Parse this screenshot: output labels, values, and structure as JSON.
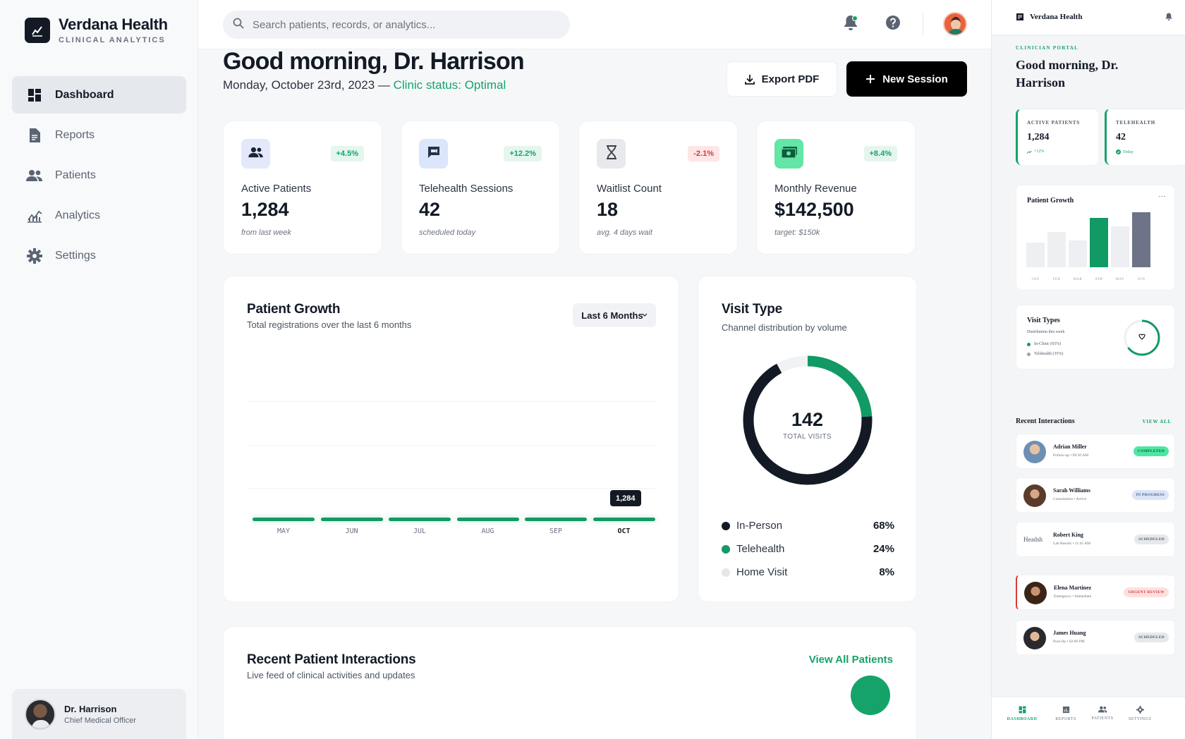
{
  "brand": {
    "name": "Verdana Health",
    "subtitle": "CLINICAL ANALYTICS"
  },
  "sidebar": {
    "items": [
      {
        "label": "Dashboard",
        "icon": "dashboard-icon",
        "active": true
      },
      {
        "label": "Reports",
        "icon": "document-icon",
        "active": false
      },
      {
        "label": "Patients",
        "icon": "users-icon",
        "active": false
      },
      {
        "label": "Analytics",
        "icon": "chart-icon",
        "active": false
      },
      {
        "label": "Settings",
        "icon": "gear-icon",
        "active": false
      }
    ],
    "user": {
      "name": "Dr. Harrison",
      "role": "Chief Medical Officer"
    }
  },
  "topbar": {
    "search_placeholder": "Search patients, records, or analytics...",
    "has_notification": true
  },
  "header": {
    "greeting": "Good morning, Dr. Harrison",
    "date": "Monday, October 23rd, 2023 — ",
    "status": "Clinic status: Optimal",
    "export_label": "Export PDF",
    "new_session_label": "New Session"
  },
  "stats": [
    {
      "label": "Active Patients",
      "value": "1,284",
      "delta": "+4.5%",
      "trend": "up",
      "note": "from last week",
      "icon": "users-icon",
      "tint": "#e3e8fb",
      "ink": "#1f2433"
    },
    {
      "label": "Telehealth Sessions",
      "value": "42",
      "delta": "+12.2%",
      "trend": "up",
      "note": "scheduled today",
      "icon": "video-chat-icon",
      "tint": "#dbe5fb",
      "ink": "#273049"
    },
    {
      "label": "Waitlist Count",
      "value": "18",
      "delta": "-2.1%",
      "trend": "down",
      "note": "avg. 4 days wait",
      "icon": "hourglass-icon",
      "tint": "#e8e9ec",
      "ink": "#3b3f47"
    },
    {
      "label": "Monthly Revenue",
      "value": "$142,500",
      "delta": "+8.4%",
      "trend": "up",
      "note": "target: $150k",
      "icon": "cash-icon",
      "tint": "#63e6a6",
      "ink": "#0d5c3d"
    }
  ],
  "growth": {
    "title": "Patient Growth",
    "subtitle": "Total registrations over the last 6 months",
    "range_label": "Last 6 Months",
    "tooltip": "1,284"
  },
  "chart_data": {
    "type": "bar",
    "categories": [
      "MAY",
      "JUN",
      "JUL",
      "AUG",
      "SEP",
      "OCT"
    ],
    "values": [
      0,
      0,
      0,
      0,
      0,
      0
    ],
    "highlight": "OCT",
    "grid": true
  },
  "visit_type": {
    "title": "Visit Type",
    "subtitle": "Channel distribution by volume",
    "total": "142",
    "total_label": "TOTAL VISITS",
    "legend": [
      {
        "label": "In-Person",
        "pct": "68%",
        "value": 68,
        "color": "#131a26"
      },
      {
        "label": "Telehealth",
        "pct": "24%",
        "value": 24,
        "color": "#129a64"
      },
      {
        "label": "Home Visit",
        "pct": "8%",
        "value": 8,
        "color": "#e5e7ea"
      }
    ]
  },
  "recent": {
    "title": "Recent Patient Interactions",
    "subtitle": "Live feed of clinical activities and updates",
    "view_all": "View All Patients"
  },
  "preview": {
    "brand": "Verdana Health",
    "kicker": "CLINICIAN PORTAL",
    "greeting": "Good morning, Dr. Harrison",
    "stats": [
      {
        "key": "ACTIVE PATIENTS",
        "value": "1,284",
        "note": "+12%"
      },
      {
        "key": "TELEHEALTH",
        "value": "42",
        "note": "Today"
      }
    ],
    "growth_title": "Patient Growth",
    "growth_more": "···",
    "growth_bars": [
      {
        "month": "JAN",
        "value": 35,
        "color": "#eeeff2"
      },
      {
        "month": "FEB",
        "value": 50,
        "color": "#eeeff2"
      },
      {
        "month": "MAR",
        "value": 38,
        "color": "#eeeff2"
      },
      {
        "month": "APR",
        "value": 70,
        "color": "#129a64"
      },
      {
        "month": "MAY",
        "value": 58,
        "color": "#eeeff2"
      },
      {
        "month": "JUN",
        "value": 78,
        "color": "#6e7487"
      }
    ],
    "visit_title": "Visit Types",
    "visit_sub": "Distribution this week",
    "visit_legend": [
      {
        "label": "In-Clinic (65%)",
        "color": "#129a64"
      },
      {
        "label": "Telehealth (35%)",
        "color": "#9aa1ab"
      }
    ],
    "visit_ring_value": 65,
    "recent_title": "Recent Interactions",
    "recent_view_all": "VIEW ALL",
    "rows": [
      {
        "name": "Adrian Miller",
        "sub": "Follow-up • 09:30 AM",
        "badge": "COMPLETED",
        "kind": "completed",
        "avatar": "#6d8fb3"
      },
      {
        "name": "Sarah Williams",
        "sub": "Consultation • Active",
        "badge": "IN PROGRESS",
        "kind": "progress",
        "avatar": "#5a3b2c"
      },
      {
        "name": "Robert King",
        "sub": "Lab Results • 11:45 AM",
        "badge": "SCHEDULED",
        "kind": "scheduled",
        "avatar": "",
        "broken_image_text": "Headsh"
      },
      {
        "name": "Elena Martinez",
        "sub": "Emergency • Immediate",
        "badge": "URGENT REVIEW",
        "kind": "urgent",
        "avatar": "#3a2418"
      },
      {
        "name": "James Huang",
        "sub": "Post-Op • 02:00 PM",
        "badge": "SCHEDULED",
        "kind": "scheduled",
        "avatar": "#2a2a2e"
      }
    ],
    "nav": [
      {
        "label": "DASHBOARD",
        "active": true,
        "icon": "dashboard-icon"
      },
      {
        "label": "REPORTS",
        "active": false,
        "icon": "report-icon"
      },
      {
        "label": "PATIENTS",
        "active": false,
        "icon": "users-icon"
      },
      {
        "label": "SETTINGS",
        "active": false,
        "icon": "gear-icon"
      }
    ]
  }
}
